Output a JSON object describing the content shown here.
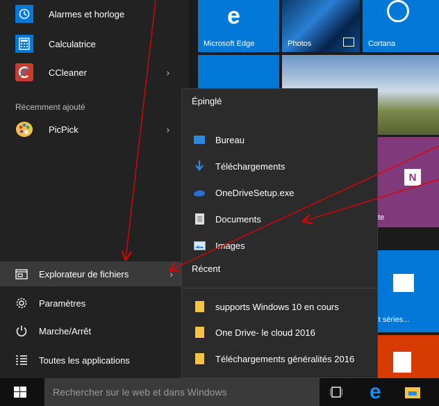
{
  "apps": {
    "alarmes": "Alarmes et horloge",
    "calculatrice": "Calculatrice",
    "ccleaner": "CCleaner",
    "section_recent": "Récemment ajouté",
    "picpick": "PicPick"
  },
  "bottom": {
    "explorateur": "Explorateur de fichiers",
    "parametres": "Paramètres",
    "marche": "Marche/Arrêt",
    "toutes": "Toutes les applications"
  },
  "tiles": {
    "edge": "Microsoft Edge",
    "photos": "Photos",
    "cortana": "Cortana",
    "note": "Note",
    "films": "s et séries..."
  },
  "flyout": {
    "pinned_header": "Épinglé",
    "pinned": [
      "Bureau",
      "Téléchargements",
      "OneDriveSetup.exe",
      "Documents",
      "Images"
    ],
    "recent_header": "Récent",
    "recent": [
      "supports Windows 10 en cours",
      "One Drive- le cloud 2016",
      "Téléchargements généralités 2016"
    ]
  },
  "taskbar": {
    "search_placeholder": "Rechercher sur le web et dans Windows"
  },
  "colors": {
    "tile_blue": "#0078d7",
    "onenote_purple": "#80397b",
    "office_red": "#d83b01",
    "annotation_red": "#e00000"
  }
}
